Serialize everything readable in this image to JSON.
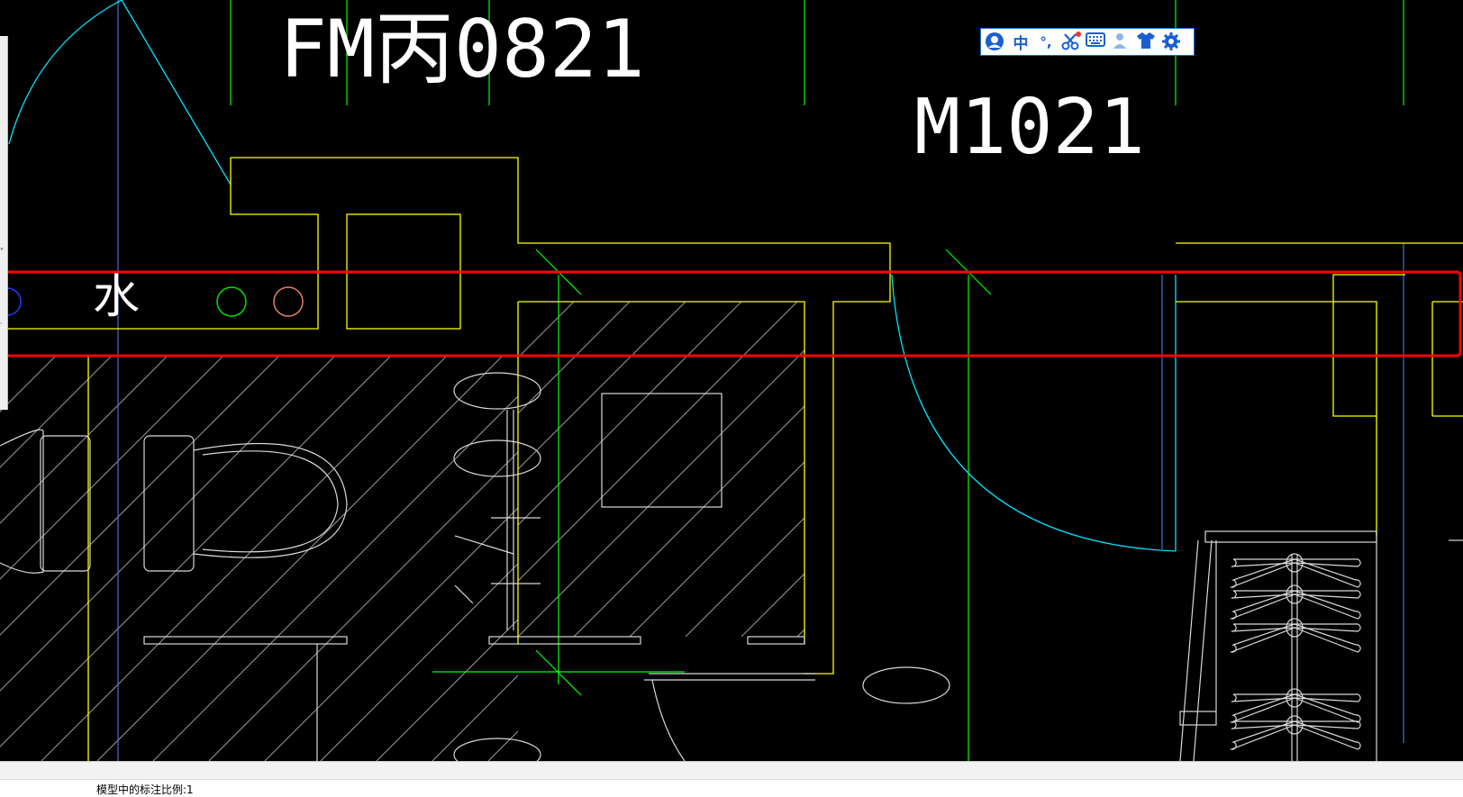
{
  "drawing": {
    "labels": {
      "door_label_1": "FM丙0821",
      "door_label_2": "M1021",
      "water_label": "水"
    }
  },
  "ime_toolbar": {
    "items": [
      {
        "name": "user-avatar-icon",
        "label": ""
      },
      {
        "name": "chinese-mode-toggle",
        "label": "中"
      },
      {
        "name": "punctuation-icon",
        "label": "°,"
      },
      {
        "name": "scissors-icon",
        "label": ""
      },
      {
        "name": "keyboard-icon",
        "label": ""
      },
      {
        "name": "person-icon",
        "label": ""
      },
      {
        "name": "skin-shirt-icon",
        "label": ""
      },
      {
        "name": "settings-gear-icon",
        "label": ""
      }
    ]
  },
  "highlight": {
    "color": "#ff0000"
  },
  "colors": {
    "background": "#000000",
    "yellow": "#ffff00",
    "cyan": "#00ffff",
    "green": "#00ff00",
    "white": "#ffffff",
    "hatch": "#b0b0b0",
    "accent": "#1a5fd0"
  },
  "status": {
    "command_text": "模型中的标注比例:1"
  }
}
